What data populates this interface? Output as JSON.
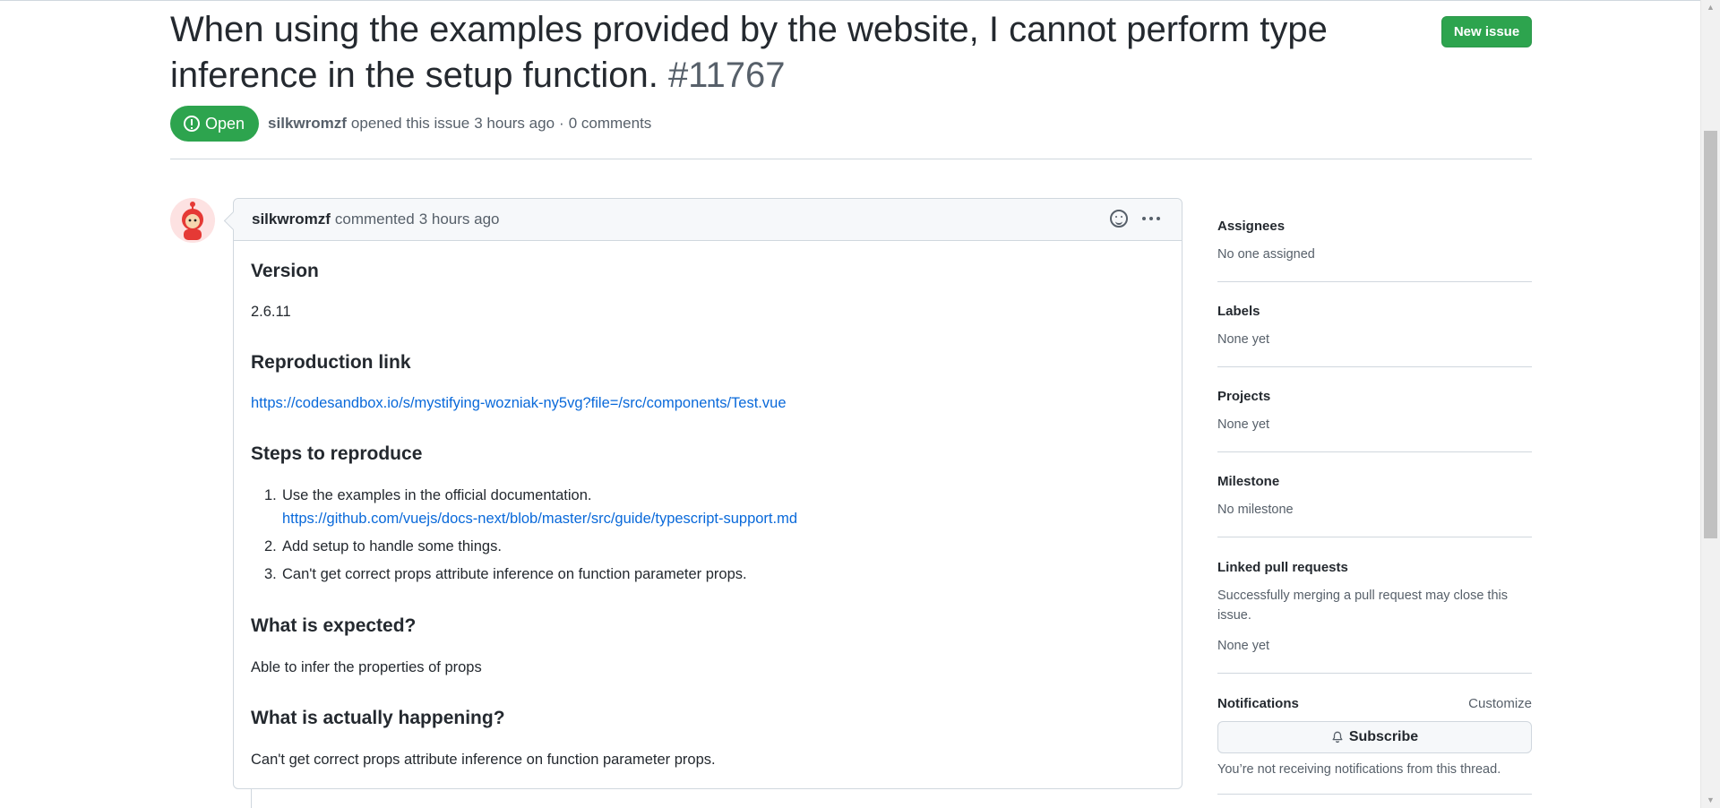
{
  "issue": {
    "title": "When using the examples provided by the website, I cannot perform type inference in the setup function.",
    "number": "#11767",
    "new_issue_label": "New issue",
    "state_label": "Open",
    "author": "silkwromzf",
    "opened_text": "opened this issue",
    "opened_time": "3 hours ago",
    "separator": "·",
    "comments_count": "0 comments"
  },
  "comment": {
    "author": "silkwromzf",
    "action": "commented",
    "time": "3 hours ago",
    "sections": {
      "version_heading": "Version",
      "version_value": "2.6.11",
      "repro_heading": "Reproduction link",
      "repro_link": "https://codesandbox.io/s/mystifying-wozniak-ny5vg?file=/src/components/Test.vue",
      "steps_heading": "Steps to reproduce",
      "steps": [
        {
          "num": "1.",
          "text": "Use the examples in the official documentation."
        },
        {
          "num": "2.",
          "text": "Add setup to handle some things."
        },
        {
          "num": "3.",
          "text": "Can't get correct props attribute inference on function parameter props."
        }
      ],
      "step1_link": "https://github.com/vuejs/docs-next/blob/master/src/guide/typescript-support.md",
      "expected_heading": "What is expected?",
      "expected_text": "Able to infer the properties of props",
      "actual_heading": "What is actually happening?",
      "actual_text": "Can't get correct props attribute inference on function parameter props."
    }
  },
  "sidebar": {
    "assignees": {
      "heading": "Assignees",
      "value": "No one assigned"
    },
    "labels": {
      "heading": "Labels",
      "value": "None yet"
    },
    "projects": {
      "heading": "Projects",
      "value": "None yet"
    },
    "milestone": {
      "heading": "Milestone",
      "value": "No milestone"
    },
    "linked_prs": {
      "heading": "Linked pull requests",
      "description": "Successfully merging a pull request may close this issue.",
      "value": "None yet"
    },
    "notifications": {
      "heading": "Notifications",
      "customize_label": "Customize",
      "subscribe_label": "Subscribe",
      "status_text": "You’re not receiving notifications from this thread."
    }
  },
  "icons": {
    "state": "issue-opened-icon",
    "reaction": "smiley-icon",
    "more": "kebab-horizontal-icon",
    "subscribe": "bell-icon"
  },
  "colors": {
    "open_green": "#2da44e",
    "link_blue": "#0969da",
    "muted": "#57606a",
    "border": "#d0d7de"
  }
}
